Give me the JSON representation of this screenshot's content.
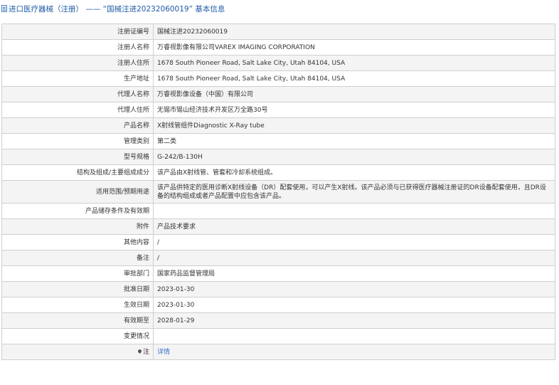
{
  "header": {
    "title": "进口医疗器械（注册） —— “国械注进20232060019” 基本信息"
  },
  "rows": [
    {
      "label": "注册证编号",
      "value": "国械注进20232060019"
    },
    {
      "label": "注册人名称",
      "value": "万睿视影像有限公司VAREX IMAGING CORPORATION"
    },
    {
      "label": "注册人住所",
      "value": "1678 South Pioneer Road, Salt Lake City, Utah 84104, USA"
    },
    {
      "label": "生产地址",
      "value": "1678 South Pioneer Road, Salt Lake City, Utah 84104, USA"
    },
    {
      "label": "代理人名称",
      "value": "万睿视影像设备（中国）有限公司"
    },
    {
      "label": "代理人住所",
      "value": "无锡市锡山经济技术开发区万全路30号"
    },
    {
      "label": "产品名称",
      "value": "X射线管组件Diagnostic X-Ray tube"
    },
    {
      "label": "管理类别",
      "value": "第二类"
    },
    {
      "label": "型号规格",
      "value": "G-242/B-130H"
    },
    {
      "label": "结构及组成/主要组成成分",
      "value": "该产品由X射线管、管套和冷却系统组成。"
    },
    {
      "label": "适用范围/预期用途",
      "value": "该产品供特定的医用诊断X射线设备（DR）配套使用，可以产生X射线。该产品必须与已获得医疗器械注册证的DR设备配套使用，且DR设备的结构组成或者产品配置中应包含该产品。"
    },
    {
      "label": "产品储存条件及有效期",
      "value": ""
    },
    {
      "label": "附件",
      "value": "产品技术要求"
    },
    {
      "label": "其他内容",
      "value": "/"
    },
    {
      "label": "备注",
      "value": "/"
    },
    {
      "label": "审批部门",
      "value": "国家药品监督管理局"
    },
    {
      "label": "批准日期",
      "value": "2023-01-30"
    },
    {
      "label": "生效日期",
      "value": "2023-01-30"
    },
    {
      "label": "有效期至",
      "value": "2028-01-29"
    },
    {
      "label": "变更情况",
      "value": ""
    },
    {
      "label": "注",
      "value": "详情"
    }
  ]
}
